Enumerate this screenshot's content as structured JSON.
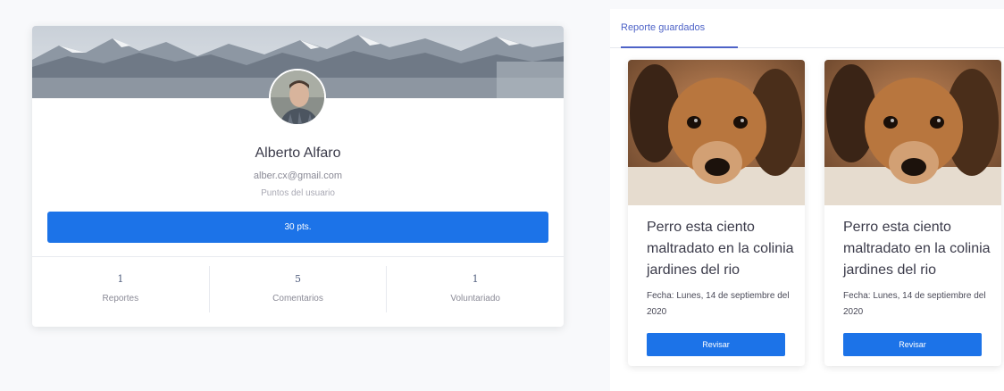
{
  "profile": {
    "name": "Alberto Alfaro",
    "email": "alber.cx@gmail.com",
    "points_label": "Puntos del usuario",
    "points_button": "30 pts.",
    "stats": [
      {
        "value": "1",
        "label": "Reportes"
      },
      {
        "value": "5",
        "label": "Comentarios"
      },
      {
        "value": "1",
        "label": "Voluntariado"
      }
    ]
  },
  "reports_panel": {
    "tab_label": "Reporte guardados",
    "reports": [
      {
        "title": "Perro esta ciento maltradato en la colinia jardines del rio",
        "date": "Fecha: Lunes, 14 de septiembre del 2020",
        "button": "Revisar"
      },
      {
        "title": "Perro esta ciento maltradato en la colinia jardines del rio",
        "date": "Fecha: Lunes, 14 de septiembre del 2020",
        "button": "Revisar"
      }
    ]
  },
  "colors": {
    "primary_button": "#1c73e8",
    "tab_accent": "#4e63c7",
    "page_background": "#f8f9fb"
  }
}
